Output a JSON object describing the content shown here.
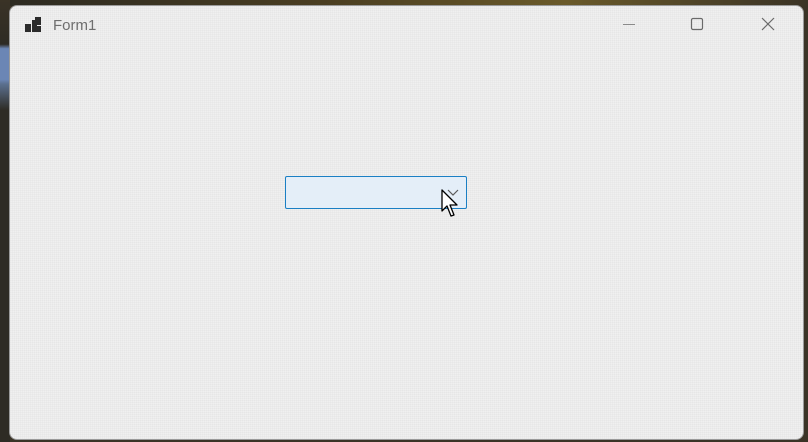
{
  "window": {
    "title": "Form1",
    "icon": "winforms-app-icon",
    "controls": {
      "minimize_icon": "minimize-icon",
      "maximize_icon": "maximize-icon",
      "close_icon": "close-icon"
    }
  },
  "combobox": {
    "value": "",
    "arrow_icon": "chevron-down-icon",
    "state": "hover"
  },
  "colors": {
    "form_background": "#f0f0f0",
    "combobox_border": "#1a7fc4",
    "combobox_hover_fill": "#e4eef8",
    "title_text": "#6e6e6e"
  }
}
